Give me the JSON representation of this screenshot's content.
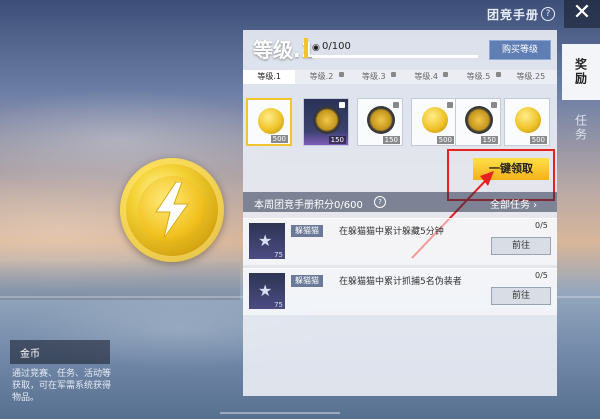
{
  "header": {
    "title": "团竞手册",
    "help": "?",
    "close": "✕"
  },
  "side_tabs": [
    {
      "label": "奖励",
      "active": true
    },
    {
      "label": "任务",
      "active": false
    }
  ],
  "left_item": {
    "name": "金币",
    "description": "通过竞赛、任务、活动等获取，可在军需系统获得物品。"
  },
  "panel": {
    "level_label": "等级.1",
    "xp_text": "0/100",
    "buy_level_label": "购买等级",
    "level_tabs": [
      {
        "label": "等级.1",
        "active": true,
        "locked": false
      },
      {
        "label": "等级.2",
        "active": false,
        "locked": true
      },
      {
        "label": "等级.3",
        "active": false,
        "locked": true
      },
      {
        "label": "等级.4",
        "active": false,
        "locked": true
      },
      {
        "label": "等级.5",
        "active": false,
        "locked": true
      },
      {
        "label": "等级.25",
        "active": false,
        "locked": false
      }
    ],
    "rewards": [
      {
        "type": "coin",
        "qty": "500",
        "bg": "light",
        "selected": true
      },
      {
        "type": "badge",
        "qty": "150",
        "bg": "blue",
        "locked": true
      },
      {
        "type": "badge",
        "qty": "150",
        "bg": "light",
        "locked": true
      },
      {
        "type": "coin",
        "qty": "500",
        "bg": "light",
        "locked": true
      },
      {
        "type": "badge",
        "qty": "150",
        "bg": "light",
        "locked": true
      },
      {
        "type": "coin",
        "qty": "500",
        "bg": "light"
      }
    ],
    "claim_all_label": "一键领取"
  },
  "weekly": {
    "title": "本周团竞手册积分0/600",
    "all_tasks_label": "全部任务",
    "tasks": [
      {
        "tag": "躲猫猫",
        "desc": "在躲猫猫中累计躲藏5分钟",
        "progress": "0/5",
        "go": "前往",
        "level": "75"
      },
      {
        "tag": "躲猫猫",
        "desc": "在躲猫猫中累计抓捕5名伪装者",
        "progress": "0/5",
        "go": "前往",
        "level": "75"
      }
    ]
  },
  "colors": {
    "accent_yellow": "#f2c52c",
    "highlight_red": "#e82020",
    "button_blue": "#5f7fb4"
  }
}
